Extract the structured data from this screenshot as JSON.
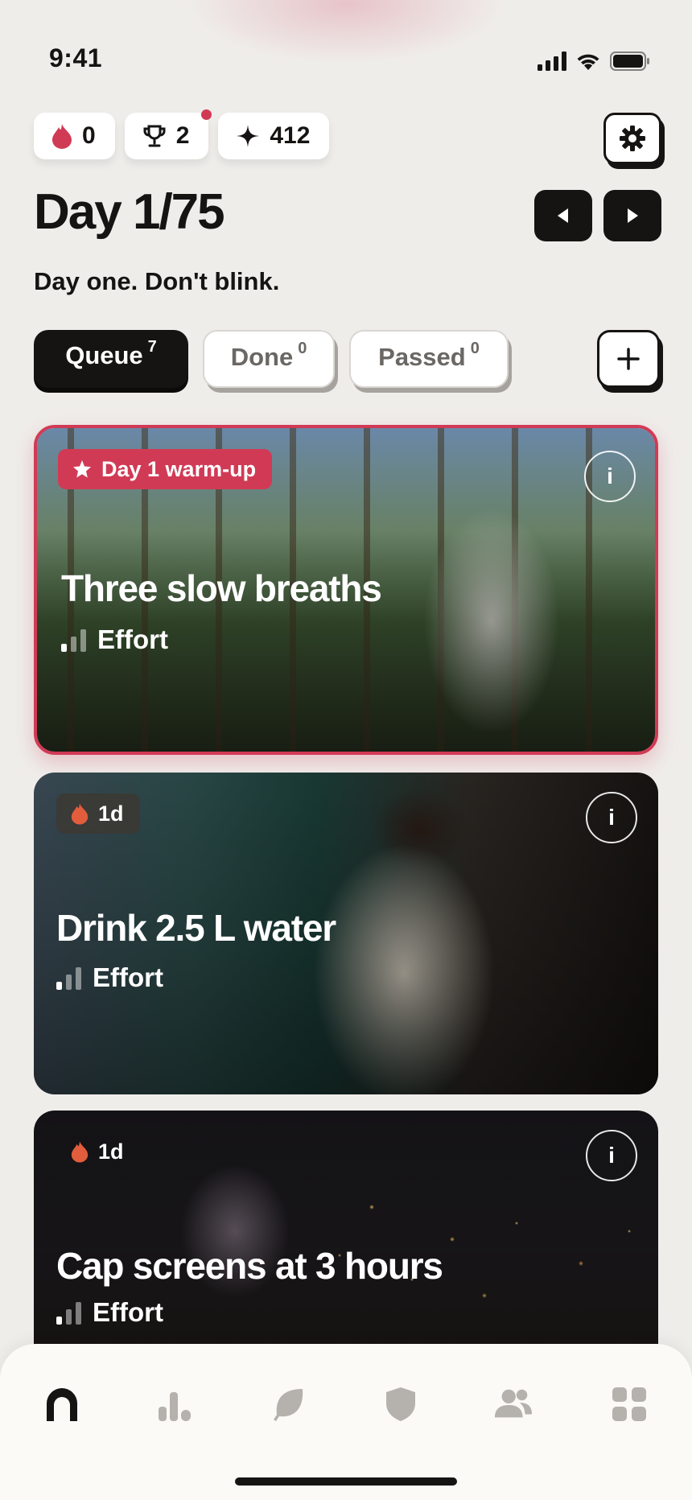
{
  "status_bar": {
    "time": "9:41"
  },
  "stats": {
    "streak": "0",
    "trophies": "2",
    "points": "412"
  },
  "header": {
    "day_label": "Day 1/75",
    "subtitle": "Day one. Don't blink."
  },
  "tabs": [
    {
      "label": "Queue",
      "count": "7",
      "active": true
    },
    {
      "label": "Done",
      "count": "0",
      "active": false
    },
    {
      "label": "Passed",
      "count": "0",
      "active": false
    }
  ],
  "cards": [
    {
      "badge": "Day 1 warm-up",
      "title": "Three slow breaths",
      "effort_label": "Effort",
      "effort_level": 1,
      "info": "i"
    },
    {
      "badge": "1d",
      "title": "Drink 2.5 L water",
      "effort_label": "Effort",
      "effort_level": 1,
      "info": "i"
    },
    {
      "badge": "1d",
      "title": "Cap screens at 3 hours",
      "effort_label": "Effort",
      "effort_level": 1,
      "info": "i"
    }
  ],
  "bottom_nav": [
    "home-icon",
    "stats-icon",
    "leaf-icon",
    "shield-icon",
    "people-icon",
    "grid-icon"
  ],
  "colors": {
    "accent": "#d13a55",
    "dark": "#161413",
    "flame": "#e25d3c"
  }
}
